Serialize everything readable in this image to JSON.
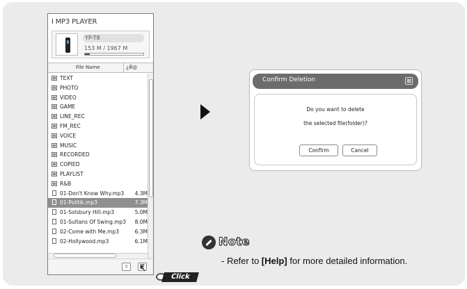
{
  "player": {
    "title": "I MP3 PLAYER",
    "model": "YP-T8",
    "capacity": "153 M / 1967 M",
    "capacity_fraction": 0.078,
    "column_header": "File Name",
    "column_icon": "¿ê◎",
    "files": [
      {
        "type": "folder",
        "name": "TEXT",
        "size": ""
      },
      {
        "type": "folder",
        "name": "PHOTO",
        "size": ""
      },
      {
        "type": "folder",
        "name": "VIDEO",
        "size": ""
      },
      {
        "type": "folder",
        "name": "GAME",
        "size": ""
      },
      {
        "type": "folder",
        "name": "LINE_REC",
        "size": ""
      },
      {
        "type": "folder",
        "name": "FM_REC",
        "size": ""
      },
      {
        "type": "folder",
        "name": "VOICE",
        "size": ""
      },
      {
        "type": "folder",
        "name": "MUSIC",
        "size": ""
      },
      {
        "type": "folder",
        "name": "RECORDED",
        "size": ""
      },
      {
        "type": "folder",
        "name": "COPIED",
        "size": ""
      },
      {
        "type": "folder",
        "name": "PLAYLIST",
        "size": ""
      },
      {
        "type": "folder",
        "name": "R&B",
        "size": ""
      },
      {
        "type": "file",
        "name": "01-Don't Know Why.mp3",
        "size": "4.3M"
      },
      {
        "type": "file",
        "name": "01-Politik.mp3",
        "size": "7.3M",
        "selected": true
      },
      {
        "type": "file",
        "name": "01-Solsbury Hill.mp3",
        "size": "5.0M"
      },
      {
        "type": "file",
        "name": "01-Sultans Of Swing.mp3",
        "size": "8.0M"
      },
      {
        "type": "file",
        "name": "02-Come with Me.mp3",
        "size": "6.3M"
      },
      {
        "type": "file",
        "name": "02-Hollywood.mp3",
        "size": "6.1M"
      }
    ]
  },
  "click_label": "Click",
  "dialog": {
    "title": "Confirm Deletion",
    "close_glyph": "⊠",
    "message_line1": "Do you want to delete",
    "message_line2": "the selected file(folder)?",
    "confirm_label": "Confirm",
    "cancel_label": "Cancel"
  },
  "note": {
    "title": "Note",
    "text_prefix": "- Refer to ",
    "text_bold": "[Help]",
    "text_suffix": " for more detailed information."
  }
}
